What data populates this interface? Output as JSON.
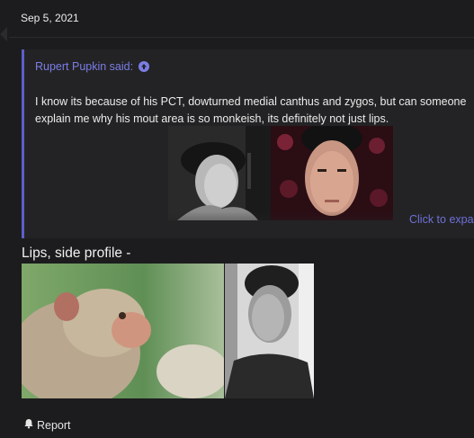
{
  "post": {
    "date": "Sep 5, 2021"
  },
  "quote": {
    "author": "Rupert Pupkin said:",
    "text": "I know its because of his PCT, dowturned medial canthus and zygos, but can someone explain me why his mout area is so monkeish, its definitely not just lips.",
    "expand_label": "Click to expand..."
  },
  "body": {
    "line": "Lips, side profile -"
  },
  "actions": {
    "report_label": "Report"
  },
  "icons": {
    "quote_link": "arrow-up-circle-icon",
    "report": "bell-icon"
  },
  "colors": {
    "background": "#1c1c1e",
    "quote_bg": "#232325",
    "accent": "#5d5fc9",
    "link": "#7b7de6"
  }
}
